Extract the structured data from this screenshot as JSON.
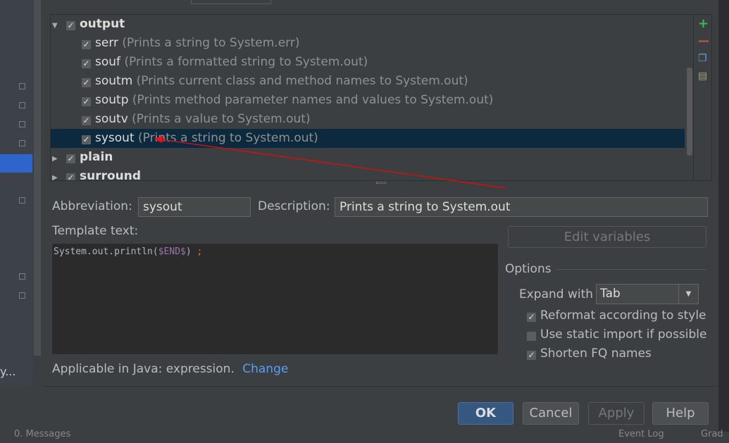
{
  "tree": {
    "groups": [
      {
        "name": "output",
        "expanded": true,
        "checked": true,
        "items": [
          {
            "abbr": "serr",
            "desc": "(Prints a string to System.err)",
            "checked": true
          },
          {
            "abbr": "souf",
            "desc": "(Prints a formatted string to System.out)",
            "checked": true
          },
          {
            "abbr": "soutm",
            "desc": "(Prints current class and method names to System.out)",
            "checked": true
          },
          {
            "abbr": "soutp",
            "desc": "(Prints method parameter names and values to System.out)",
            "checked": true
          },
          {
            "abbr": "soutv",
            "desc": "(Prints a value to System.out)",
            "checked": true
          },
          {
            "abbr": "sysout",
            "desc": "(Prints a string to System.out)",
            "checked": true,
            "selected": true
          }
        ]
      },
      {
        "name": "plain",
        "expanded": false,
        "checked": true
      },
      {
        "name": "surround",
        "expanded": false,
        "checked": true
      }
    ],
    "tools": [
      "add-icon",
      "remove-icon",
      "copy-icon",
      "edit-icon"
    ]
  },
  "form": {
    "abbreviation_label": "Abbreviation:",
    "abbreviation_value": "sysout",
    "description_label": "Description:",
    "description_value": "Prints a string to System.out",
    "template_label": "Template text:",
    "template_code": {
      "prefix": "System.out.println(",
      "var": "$END$",
      "suffix": ") ",
      "semi": ";"
    },
    "edit_variables": "Edit variables",
    "applicable": "Applicable in Java: expression.",
    "change_link": "Change"
  },
  "options": {
    "title": "Options",
    "expand_label": "Expand with",
    "expand_value": "Tab",
    "reformat": {
      "label": "Reformat according to style",
      "checked": true
    },
    "static_import": {
      "label": "Use static import if possible",
      "checked": false
    },
    "shorten_fq": {
      "label": "Shorten FQ names",
      "checked": true
    }
  },
  "buttons": {
    "ok": "OK",
    "cancel": "Cancel",
    "apply": "Apply",
    "help": "Help"
  },
  "statusbar": {
    "messages": "0. Messages",
    "event_log": "Event Log",
    "gradle": "Grad"
  },
  "sidebar": {
    "truncated": "y..."
  },
  "colors": {
    "selection": "#0d293e",
    "accent": "#2f65ca",
    "link": "#589df6",
    "annotation_arrow": "#cc1111"
  }
}
